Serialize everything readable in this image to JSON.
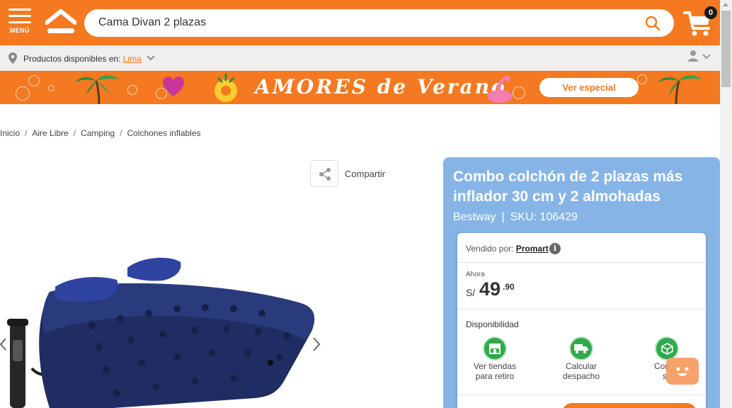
{
  "header": {
    "menu_label": "MENÚ",
    "search_value": "Cama Divan 2 plazas",
    "cart_count": "0",
    "brand_color": "#f47920"
  },
  "location": {
    "prefix": "Productos disponibles en:",
    "city": "Lima"
  },
  "banner": {
    "title": "AMORES de Verano",
    "button_label": "Ver especial"
  },
  "breadcrumb": [
    "Inicio",
    "Aire Libre",
    "Camping",
    "Colchones inflables"
  ],
  "gallery": {
    "share_label": "Compartir"
  },
  "product": {
    "title": "Combo colchón de 2 plazas más inflador 30 cm y 2 almohadas",
    "brand": "Bestway",
    "sku": "SKU: 106429",
    "seller_prefix": "Vendido por:",
    "seller": "Promart",
    "price_label": "Ahora",
    "currency": "S/",
    "price_int": "49",
    "price_dec": ".90",
    "availability_label": "Disponibilidad",
    "options": [
      {
        "line1": "Ver tiendas",
        "line2": "para retiro"
      },
      {
        "line1": "Calcular",
        "line2": "despacho"
      },
      {
        "line1": "Cons",
        "line2": "sto"
      }
    ],
    "panel_color": "#86b4e6",
    "option_color": "#2faa49"
  }
}
